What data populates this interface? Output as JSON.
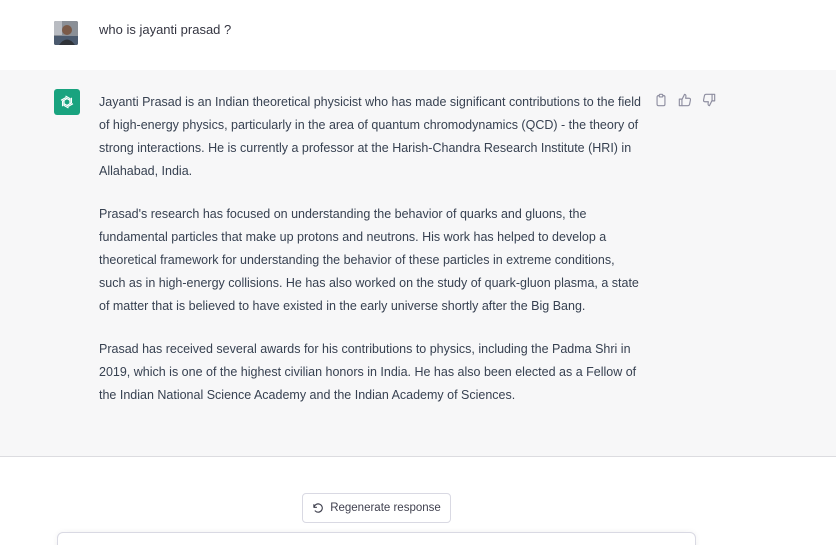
{
  "user_message": {
    "avatar_icon": "user-photo-avatar",
    "text": "who is jayanti prasad ?"
  },
  "assistant_message": {
    "avatar_icon": "openai-logo-icon",
    "avatar_color": "#19a37f",
    "paragraphs": [
      "Jayanti Prasad is an Indian theoretical physicist who has made significant contributions to the field of high-energy physics, particularly in the area of quantum chromodynamics (QCD) - the theory of strong interactions. He is currently a professor at the Harish-Chandra Research Institute (HRI) in Allahabad, India.",
      "Prasad's research has focused on understanding the behavior of quarks and gluons, the fundamental particles that make up protons and neutrons. His work has helped to develop a theoretical framework for understanding the behavior of these particles in extreme conditions, such as in high-energy collisions. He has also worked on the study of quark-gluon plasma, a state of matter that is believed to have existed in the early universe shortly after the Big Bang.",
      "Prasad has received several awards for his contributions to physics, including the Padma Shri in 2019, which is one of the highest civilian honors in India. He has also been elected as a Fellow of the Indian National Science Academy and the Indian Academy of Sciences."
    ],
    "actions": [
      "clipboard-icon",
      "thumbs-up-icon",
      "thumbs-down-icon"
    ]
  },
  "controls": {
    "regenerate_label": "Regenerate response",
    "regenerate_icon": "refresh-icon"
  }
}
